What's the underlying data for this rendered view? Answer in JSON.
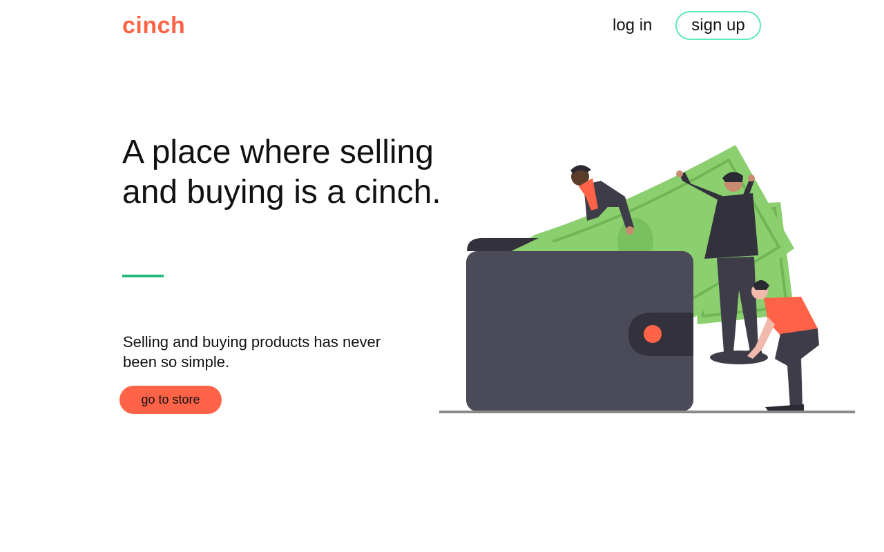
{
  "brand": {
    "logo_text": "cinch",
    "color": "#ff6347"
  },
  "nav": {
    "login_label": "log in",
    "signup_label": "sign up",
    "signup_border_color": "#5ee6c0"
  },
  "hero": {
    "title": "A place where selling and buying is a cinch.",
    "accent_rule_color": "#27b97c",
    "subtitle": "Selling and buying products has never been so simple.",
    "cta_label": "go to store",
    "cta_color": "#ff6347"
  },
  "illustration": {
    "name": "wallet-money-people-illustration",
    "colors": {
      "wallet": "#4b4a58",
      "wallet_dark": "#33323c",
      "money": "#8bcf6f",
      "money_dark": "#6fb655",
      "clasp_dot": "#ff6347",
      "shirt_accent": "#ff6347",
      "ground": "#8a8a8a"
    }
  }
}
